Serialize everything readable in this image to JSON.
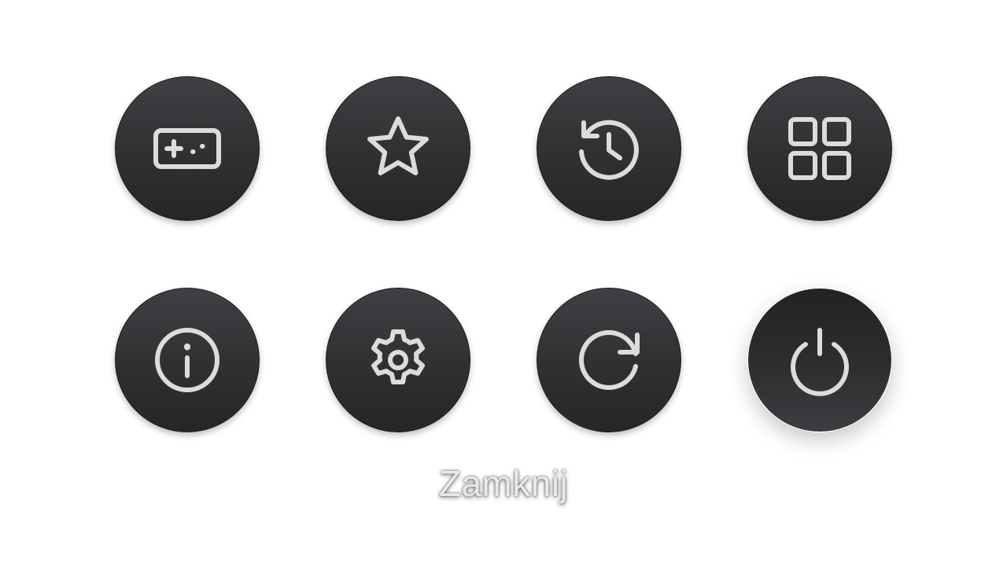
{
  "menu": {
    "focused_label": "Zamknij",
    "colors": {
      "button_background": "#2f3032",
      "icon_stroke": "#dcdcdc",
      "label_text": "#e9e9e9",
      "page_background": "#ffffff"
    },
    "buttons": [
      {
        "id": "games",
        "icon": "gamepad-icon",
        "selected": false
      },
      {
        "id": "favorites",
        "icon": "star-icon",
        "selected": false
      },
      {
        "id": "history",
        "icon": "history-icon",
        "selected": false
      },
      {
        "id": "apps",
        "icon": "grid-icon",
        "selected": false
      },
      {
        "id": "info",
        "icon": "info-icon",
        "selected": false
      },
      {
        "id": "settings",
        "icon": "gear-icon",
        "selected": false
      },
      {
        "id": "restart",
        "icon": "refresh-icon",
        "selected": false
      },
      {
        "id": "power",
        "icon": "power-icon",
        "selected": true
      }
    ]
  }
}
